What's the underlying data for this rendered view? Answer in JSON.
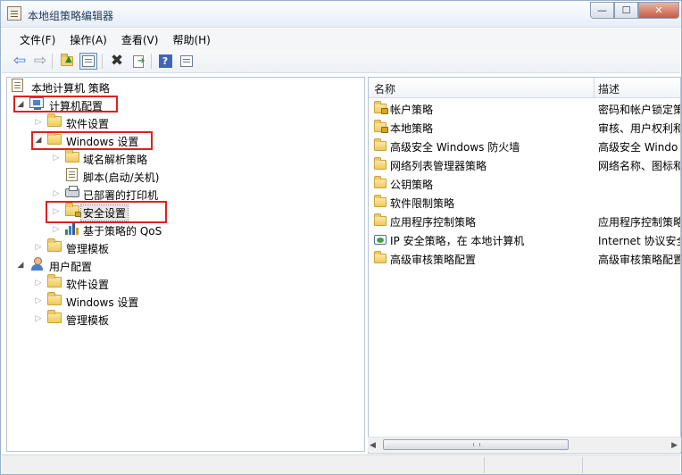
{
  "window": {
    "title": "本地组策略编辑器",
    "controls": {
      "minimize": "—",
      "maximize": "☐",
      "close": "✕"
    }
  },
  "menu": {
    "items": [
      "文件(F)",
      "操作(A)",
      "查看(V)",
      "帮助(H)"
    ]
  },
  "toolbar": {
    "buttons": [
      {
        "name": "back",
        "icon": "arrow-left-icon",
        "glyph": "⇦"
      },
      {
        "name": "forward",
        "icon": "arrow-right-icon",
        "glyph": "⇨"
      },
      {
        "name": "up",
        "icon": "folder-up-icon"
      },
      {
        "name": "show-hide-tree",
        "icon": "console-tree-icon"
      },
      {
        "name": "delete",
        "icon": "delete-x-icon",
        "glyph": "✖"
      },
      {
        "name": "export-list",
        "icon": "export-icon"
      },
      {
        "name": "help",
        "icon": "help-icon",
        "glyph": "?"
      },
      {
        "name": "extended-view",
        "icon": "extended-view-icon"
      }
    ]
  },
  "tree": {
    "root": "本地计算机 策略",
    "nodes": [
      {
        "label": "计算机配置",
        "icon": "computer-icon",
        "expanded": true,
        "highlighted": true
      },
      {
        "label": "软件设置",
        "icon": "folder-icon",
        "expanded": false
      },
      {
        "label": "Windows 设置",
        "icon": "folder-icon",
        "expanded": true,
        "highlighted": true
      },
      {
        "label": "域名解析策略",
        "icon": "folder-icon",
        "expanded": false
      },
      {
        "label": "脚本(启动/关机)",
        "icon": "script-doc-icon",
        "expanded": null
      },
      {
        "label": "已部署的打印机",
        "icon": "printer-icon",
        "expanded": false
      },
      {
        "label": "安全设置",
        "icon": "security-folder-icon",
        "expanded": false,
        "selected": true,
        "highlighted": true
      },
      {
        "label": "基于策略的 QoS",
        "icon": "qos-chart-icon",
        "expanded": false
      },
      {
        "label": "管理模板",
        "icon": "folder-icon",
        "expanded": false
      },
      {
        "label": "用户配置",
        "icon": "user-icon",
        "expanded": true
      },
      {
        "label": "软件设置",
        "icon": "folder-icon",
        "expanded": false
      },
      {
        "label": "Windows 设置",
        "icon": "folder-icon",
        "expanded": false
      },
      {
        "label": "管理模板",
        "icon": "folder-icon",
        "expanded": false
      }
    ]
  },
  "list": {
    "columns": [
      "名称",
      "描述"
    ],
    "rows": [
      {
        "name": "帐户策略",
        "desc": "密码和帐户锁定策",
        "icon": "lock-folder-icon"
      },
      {
        "name": "本地策略",
        "desc": "审核、用户权利和",
        "icon": "lock-folder-icon"
      },
      {
        "name": "高级安全 Windows 防火墙",
        "desc": "高级安全 Windo",
        "icon": "folder-icon"
      },
      {
        "name": "网络列表管理器策略",
        "desc": "网络名称、图标和",
        "icon": "folder-icon"
      },
      {
        "name": "公钥策略",
        "desc": "",
        "icon": "folder-icon"
      },
      {
        "name": "软件限制策略",
        "desc": "",
        "icon": "folder-icon"
      },
      {
        "name": "应用程序控制策略",
        "desc": "应用程序控制策略",
        "icon": "folder-icon"
      },
      {
        "name": "IP 安全策略，在 本地计算机",
        "desc": "Internet 协议安全",
        "icon": "ipsec-icon"
      },
      {
        "name": "高级审核策略配置",
        "desc": "高级审核策略配置",
        "icon": "folder-icon"
      }
    ]
  },
  "scroll": {
    "left": "◀",
    "right": "▶"
  }
}
